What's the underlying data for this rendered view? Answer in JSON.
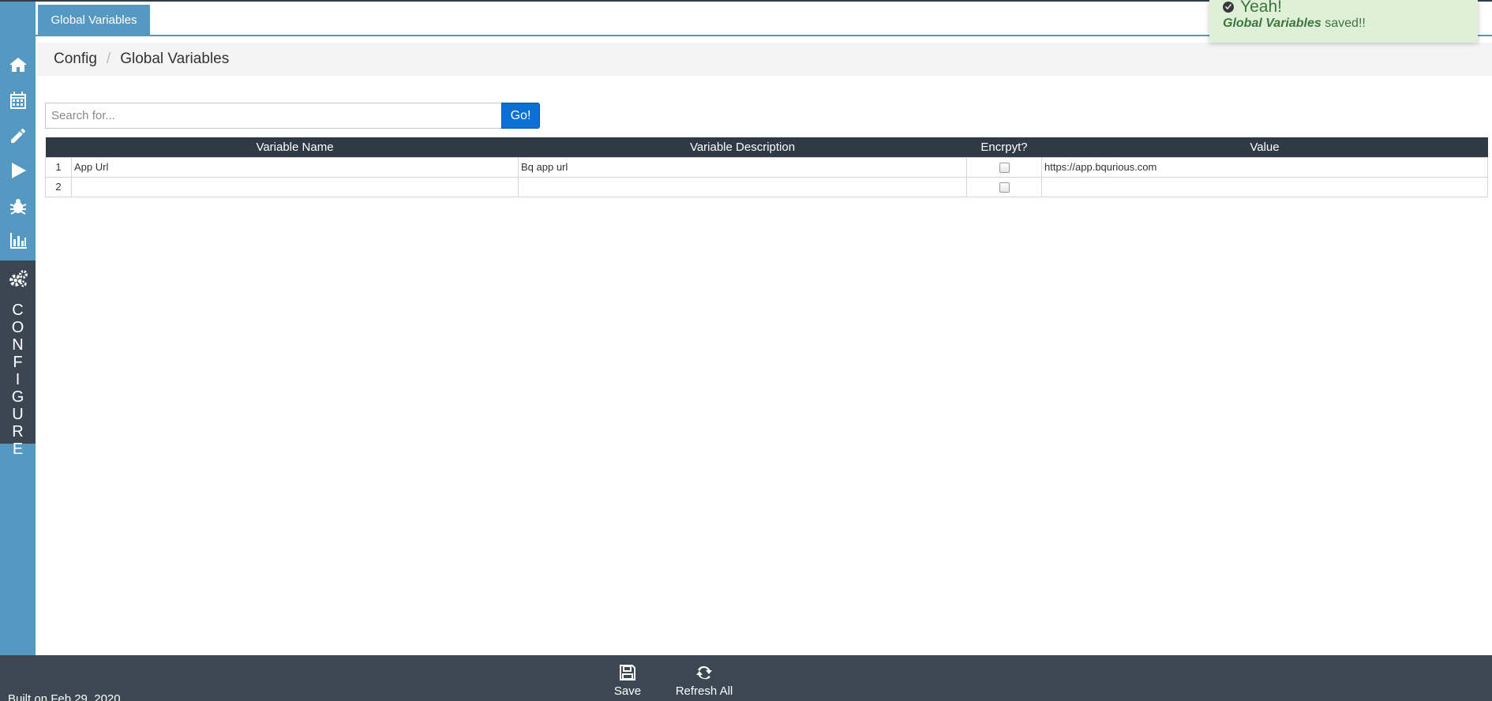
{
  "tabs": [
    {
      "label": "Global Variables"
    }
  ],
  "breadcrumb": {
    "items": [
      "Config",
      "Global Variables"
    ],
    "separator": "/"
  },
  "search": {
    "placeholder": "Search for...",
    "value": "",
    "button_label": "Go!"
  },
  "table": {
    "columns": [
      "Variable Name",
      "Variable Description",
      "Encrpyt?",
      "Value"
    ],
    "rows": [
      {
        "num": "1",
        "name": "App Url",
        "description": "Bq app url",
        "encrypt": false,
        "value": "https://app.bqurious.com"
      },
      {
        "num": "2",
        "name": "",
        "description": "",
        "encrypt": false,
        "value": ""
      }
    ]
  },
  "sidebar": {
    "icons": [
      "home-icon",
      "calendar-icon",
      "pencil-icon",
      "play-icon",
      "bug-icon",
      "bar-chart-icon",
      "gears-icon"
    ],
    "active_label": "CONFIGURE"
  },
  "toast": {
    "title": "Yeah!",
    "msg_bold": "Global Variables",
    "msg_rest": " saved!!"
  },
  "footer": {
    "save_label": "Save",
    "refresh_label": "Refresh All",
    "built_text": "Built on Feb 29, 2020"
  },
  "colors": {
    "sidebar": "#5599c2",
    "dark": "#3b4853",
    "accent_button": "#0a6fd6",
    "toast_bg": "#dff0d8"
  }
}
